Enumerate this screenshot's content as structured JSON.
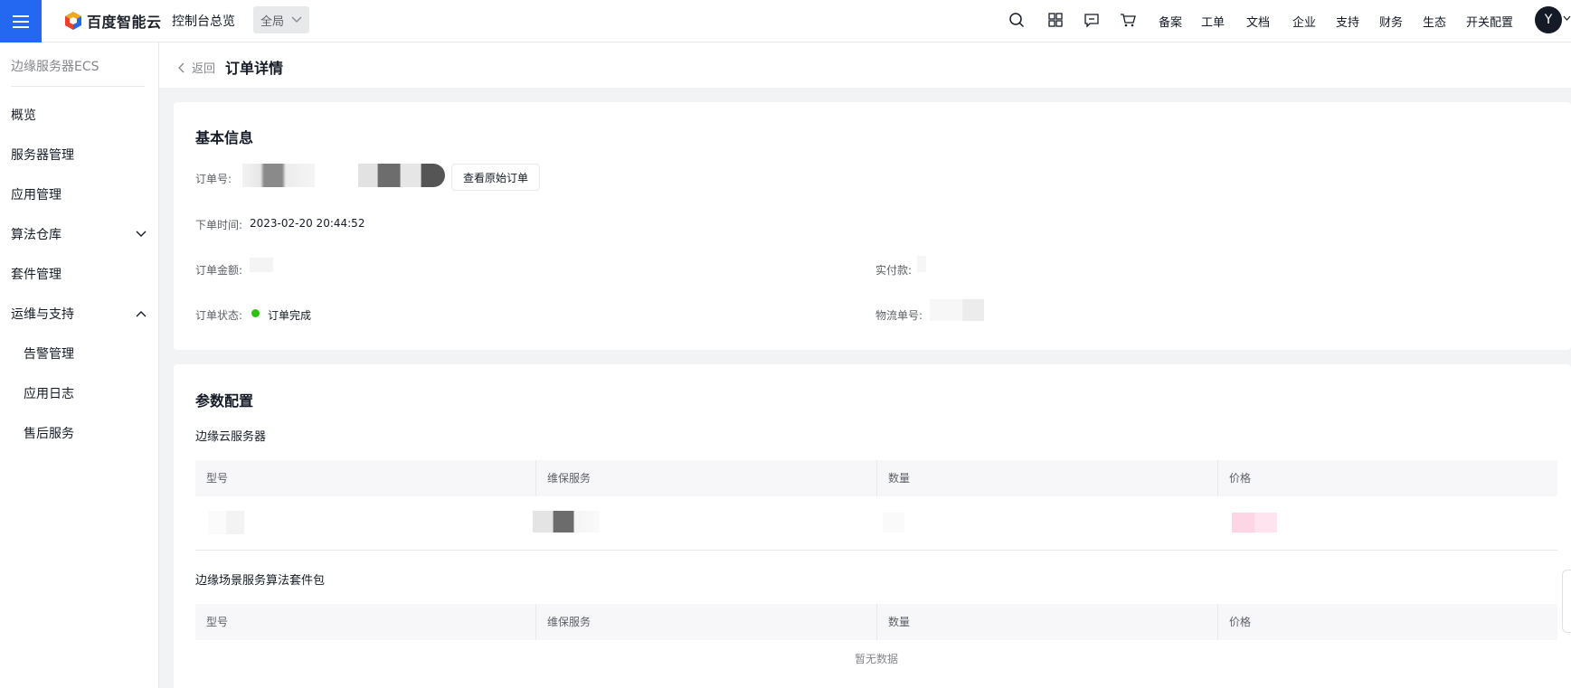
{
  "topbar": {
    "logo_text": "百度智能云",
    "console_title": "控制台总览",
    "region": "全局",
    "nav_links": [
      "备案",
      "工单",
      "文档",
      "企业",
      "支持",
      "财务",
      "生态",
      "开关配置"
    ],
    "avatar_letter": "Y",
    "brand_color": "#2468f2"
  },
  "sidebar": {
    "title": "边缘服务器ECS",
    "items": [
      {
        "label": "概览"
      },
      {
        "label": "服务器管理"
      },
      {
        "label": "应用管理"
      },
      {
        "label": "算法仓库",
        "expanded": false
      },
      {
        "label": "套件管理"
      },
      {
        "label": "运维与支持",
        "expanded": true
      }
    ],
    "sub_items": [
      {
        "label": "告警管理"
      },
      {
        "label": "应用日志"
      },
      {
        "label": "售后服务"
      }
    ]
  },
  "breadcrumb": {
    "back_label": "返回",
    "page_title": "订单详情"
  },
  "basic_info": {
    "title": "基本信息",
    "order_no_label": "订单号:",
    "view_original_button": "查看原始订单",
    "order_time_label": "下单时间:",
    "order_time_value": "2023-02-20 20:44:52",
    "order_amount_label": "订单金额:",
    "paid_label": "实付款:",
    "order_status_label": "订单状态:",
    "order_status_value": "订单完成",
    "status_color": "#30bf13",
    "logistics_label": "物流单号:"
  },
  "param_config": {
    "title": "参数配置",
    "section1_title": "边缘云服务器",
    "section2_title": "边缘场景服务算法套件包",
    "columns": [
      "型号",
      "维保服务",
      "数量",
      "价格"
    ],
    "empty_text": "暂无数据"
  }
}
